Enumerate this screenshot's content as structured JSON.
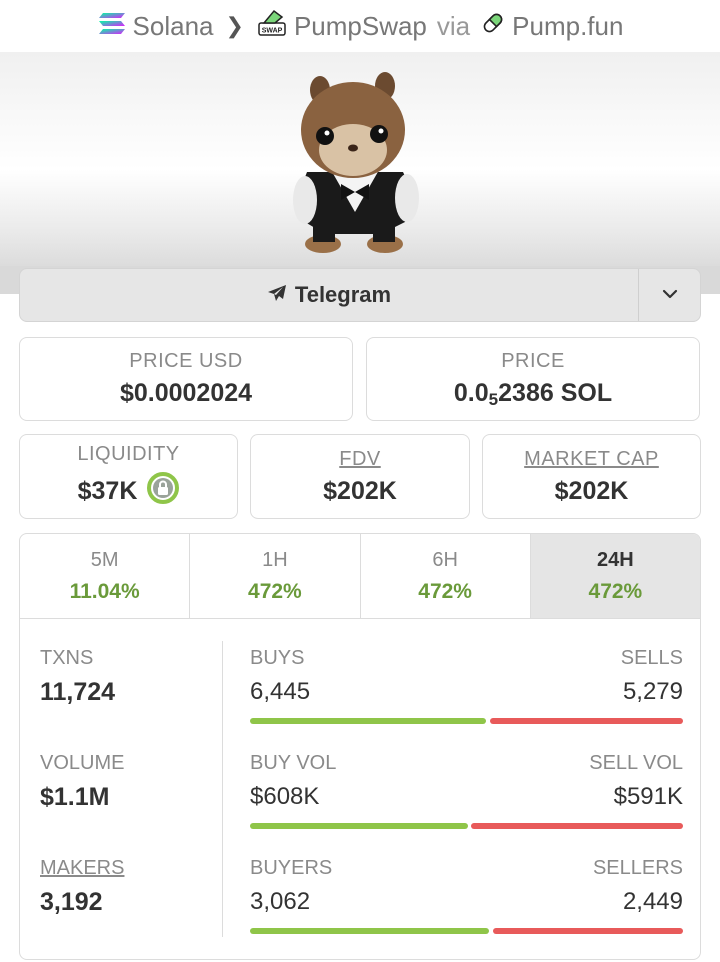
{
  "breadcrumb": {
    "chain": "Solana",
    "dex": "PumpSwap",
    "via": "via",
    "launchpad": "Pump.fun"
  },
  "socials": {
    "telegram_label": "Telegram"
  },
  "price": {
    "usd_label": "PRICE USD",
    "usd_value": "$0.0002024",
    "native_label": "PRICE",
    "native_prefix": "0.0",
    "native_zero_count": "5",
    "native_suffix": "2386 SOL"
  },
  "metrics": {
    "liquidity_label": "LIQUIDITY",
    "liquidity_value": "$37K",
    "fdv_label": "FDV",
    "fdv_value": "$202K",
    "mcap_label": "MARKET CAP",
    "mcap_value": "$202K"
  },
  "timeframes": [
    {
      "label": "5M",
      "change": "11.04%"
    },
    {
      "label": "1H",
      "change": "472%"
    },
    {
      "label": "6H",
      "change": "472%"
    },
    {
      "label": "24H",
      "change": "472%"
    }
  ],
  "active_timeframe": "24H",
  "txns": {
    "label": "TXNS",
    "value": "11,724",
    "buys_label": "BUYS",
    "buys_value": "6,445",
    "sells_label": "SELLS",
    "sells_value": "5,279",
    "buy_fraction": 0.55
  },
  "volume": {
    "label": "VOLUME",
    "value": "$1.1M",
    "buy_label": "BUY VOL",
    "buy_value": "$608K",
    "sell_label": "SELL VOL",
    "sell_value": "$591K",
    "buy_fraction": 0.507
  },
  "makers": {
    "label": "MAKERS",
    "value": "3,192",
    "buyers_label": "BUYERS",
    "buyers_value": "3,062",
    "sellers_label": "SELLERS",
    "sellers_value": "2,449",
    "buy_fraction": 0.556
  },
  "colors": {
    "positive": "#6a9a3a",
    "buy_bar": "#8fc549",
    "sell_bar": "#e85a5a"
  }
}
